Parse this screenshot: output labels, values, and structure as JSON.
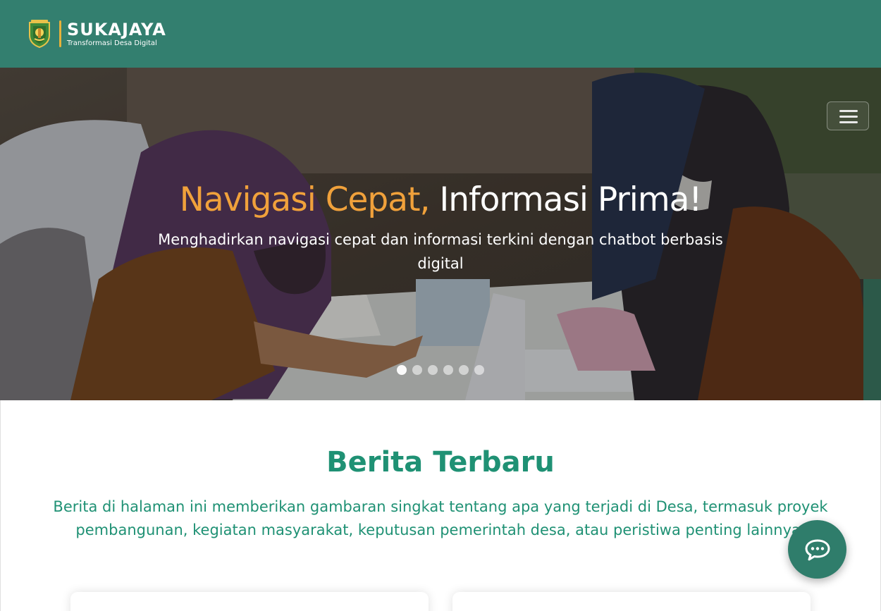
{
  "header": {
    "brand_name": "SUKAJAYA",
    "brand_tagline": "Transformasi Desa Digital",
    "logo_icon": "village-emblem-icon",
    "menu_icon": "hamburger-menu-icon"
  },
  "hero": {
    "title_accent": "Navigasi Cepat,",
    "title_rest": "Informasi Prima!",
    "subtitle": "Menghadirkan navigasi cepat dan informasi terkini dengan chatbot berbasis digital",
    "slide_count": 6,
    "active_slide": 1
  },
  "news": {
    "title": "Berita Terbaru",
    "description": "Berita di halaman ini memberikan gambaran singkat tentang apa yang terjadi di Desa, termasuk proyek pembangunan, kegiatan masyarakat, keputusan pemerintah desa, atau peristiwa penting lainnya."
  },
  "chat": {
    "icon": "chat-bubble-icon"
  },
  "colors": {
    "header_bg": "#337f6f",
    "accent_orange": "#f0a13b",
    "green_text": "#1f9174",
    "chat_button": "#2f7d6b"
  }
}
